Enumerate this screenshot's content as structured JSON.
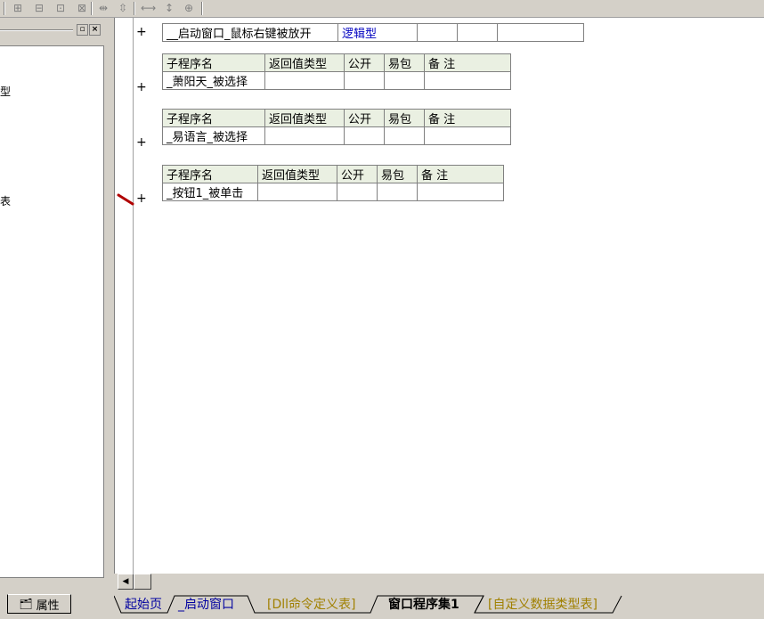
{
  "toolbar": {
    "icons": [
      "align-left-icon",
      "align-center-icon",
      "align-right-icon",
      "align-top-icon",
      "space-horizontal-icon",
      "space-vertical-icon",
      "same-width-icon",
      "same-height-icon",
      "same-size-icon"
    ]
  },
  "left_panel": {
    "truncated_texts": [
      "型",
      "表"
    ],
    "property_tab_label": "属性"
  },
  "editor": {
    "blocks": [
      {
        "type": "row",
        "name": "__启动窗口_鼠标右键被放开",
        "return_type": "逻辑型"
      },
      {
        "type": "table",
        "headers": [
          "子程序名",
          "返回值类型",
          "公开",
          "易包",
          "备 注"
        ],
        "name": "_萧阳天_被选择"
      },
      {
        "type": "table",
        "headers": [
          "子程序名",
          "返回值类型",
          "公开",
          "易包",
          "备 注"
        ],
        "name": "_易语言_被选择"
      },
      {
        "type": "table",
        "headers": [
          "子程序名",
          "返回值类型",
          "公开",
          "易包",
          "备 注"
        ],
        "name": "_按钮1_被单击"
      }
    ],
    "plus_symbol": "+"
  },
  "tabs": [
    "起始页",
    "_启动窗口",
    "[Dll命令定义表]",
    "窗口程序集1",
    "[自定义数据类型表]"
  ],
  "colors": {
    "header_bg": "#eaf0e2",
    "type_blue": "#0000c0"
  }
}
